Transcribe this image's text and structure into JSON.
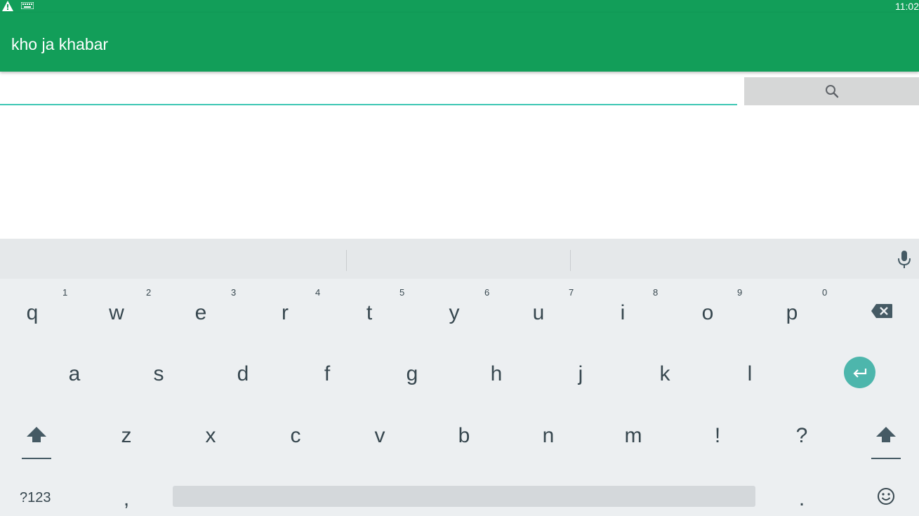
{
  "status_bar": {
    "time": "11:02",
    "icons": [
      "warning-icon",
      "keyboard-icon"
    ]
  },
  "app_bar": {
    "title": "kho ja khabar",
    "color": "#129e59"
  },
  "search": {
    "value": "",
    "placeholder": "",
    "button_icon": "search-icon",
    "underline_color": "#3fc7b4"
  },
  "keyboard": {
    "row1": [
      {
        "key": "q",
        "hint": "1"
      },
      {
        "key": "w",
        "hint": "2"
      },
      {
        "key": "e",
        "hint": "3"
      },
      {
        "key": "r",
        "hint": "4"
      },
      {
        "key": "t",
        "hint": "5"
      },
      {
        "key": "y",
        "hint": "6"
      },
      {
        "key": "u",
        "hint": "7"
      },
      {
        "key": "i",
        "hint": "8"
      },
      {
        "key": "o",
        "hint": "9"
      },
      {
        "key": "p",
        "hint": "0"
      }
    ],
    "row2": [
      "a",
      "s",
      "d",
      "f",
      "g",
      "h",
      "j",
      "k",
      "l"
    ],
    "row3": [
      "z",
      "x",
      "c",
      "v",
      "b",
      "n",
      "m",
      "!",
      "?"
    ],
    "row4": {
      "symbols": "?123",
      "comma": ",",
      "period": "."
    },
    "icons": {
      "backspace": "backspace-icon",
      "enter": "enter-icon",
      "shift": "shift-icon",
      "emoji": "emoji-icon",
      "mic": "mic-icon"
    },
    "accent_color": "#4db6ac"
  }
}
